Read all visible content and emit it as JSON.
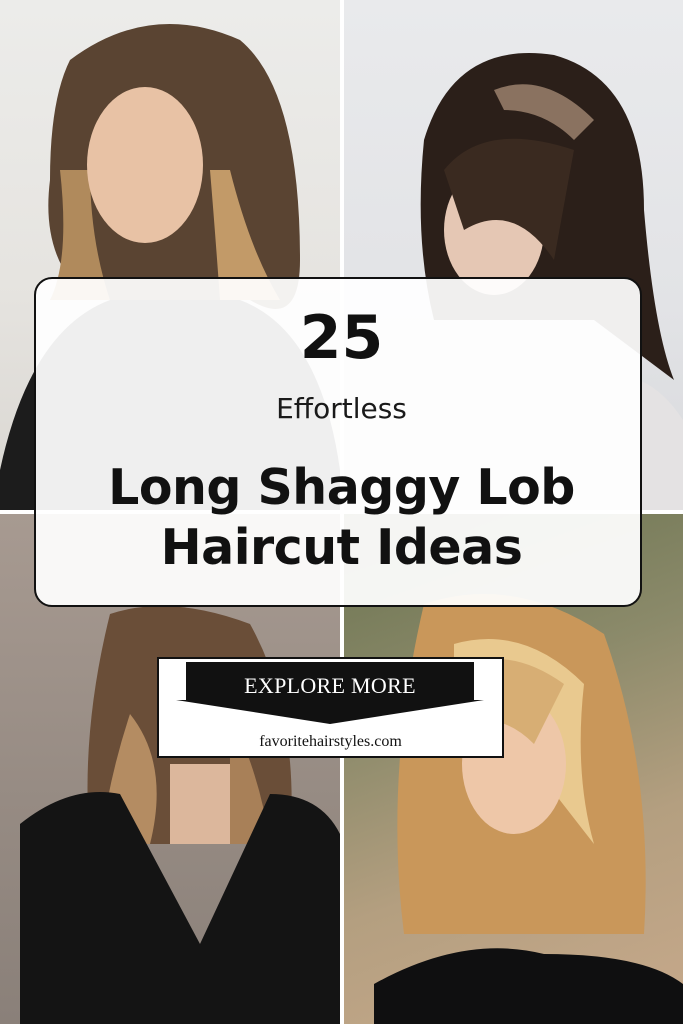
{
  "pin": {
    "number": "25",
    "subtitle": "Effortless",
    "headline": "Long Shaggy Lob Haircut Ideas"
  },
  "cta": {
    "label": "EXPLORE MORE",
    "site": "favoritehairstyles.com"
  },
  "photos": [
    {
      "name": "photo-top-left",
      "hair": "brunette-balayage-waves"
    },
    {
      "name": "photo-top-right",
      "hair": "dark-shag-with-bangs"
    },
    {
      "name": "photo-bottom-left",
      "hair": "layered-brown-lob"
    },
    {
      "name": "photo-bottom-right",
      "hair": "golden-blonde-shag"
    }
  ]
}
